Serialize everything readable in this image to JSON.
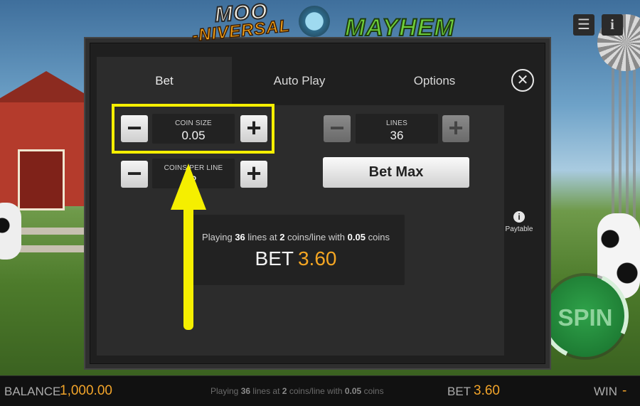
{
  "logo": {
    "line1": "MOO",
    "line2": "-NIVERSAL",
    "line3": "MAYHEM"
  },
  "top_icons": {
    "menu_icon": "☰",
    "info_icon": "i"
  },
  "modal": {
    "tabs": [
      "Bet",
      "Auto Play",
      "Options"
    ],
    "active_tab": "Bet",
    "close_glyph": "✕",
    "coin_size": {
      "label": "COIN SIZE",
      "value": "0.05",
      "minus": "−",
      "plus": "+"
    },
    "coins_per_line": {
      "label": "COINS PER LINE",
      "value": "2",
      "minus": "−",
      "plus": "+"
    },
    "lines": {
      "label": "LINES",
      "value": "36",
      "minus": "−",
      "plus": "+"
    },
    "bet_max": "Bet Max",
    "summary": {
      "prefix": "Playing",
      "lines": "36",
      "mid1": "lines at",
      "coins_per_line": "2",
      "mid2": "coins/line with",
      "coin_value": "0.05",
      "suffix": "coins",
      "bet_label": "BET",
      "bet_amount": "3.60"
    }
  },
  "paytable": {
    "label": "Paytable",
    "icon": "i"
  },
  "spin": {
    "label": "SPIN"
  },
  "bottom_bar": {
    "balance_label": "BALANCE",
    "balance_value": "1,000.00",
    "playing_prefix": "Playing",
    "playing_lines": "36",
    "playing_mid1": "lines at",
    "playing_coins": "2",
    "playing_mid2": "coins/line with",
    "playing_coin_value": "0.05",
    "playing_suffix": "coins",
    "bet_label": "BET",
    "bet_value": "3.60",
    "win_label": "WIN",
    "win_value": "-"
  },
  "colors": {
    "accent": "#f5a623",
    "highlight": "#f5ef00",
    "spin_green": "#1e7d34"
  }
}
